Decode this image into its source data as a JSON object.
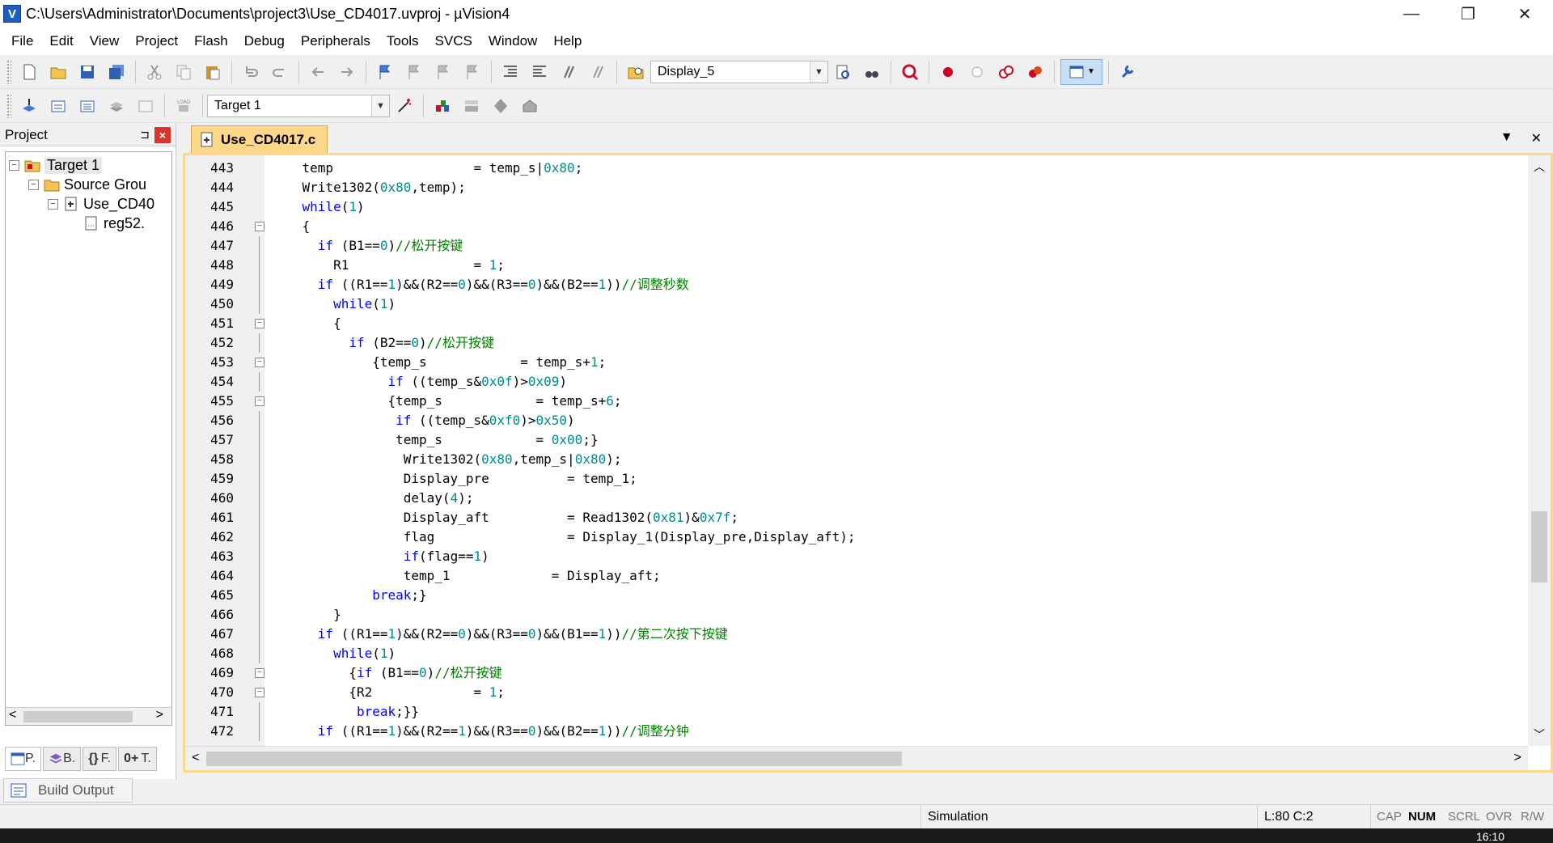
{
  "window": {
    "title": "C:\\Users\\Administrator\\Documents\\project3\\Use_CD4017.uvproj - µVision4",
    "logo": "V",
    "buttons": {
      "minimize": "—",
      "restore": "❐",
      "close": "✕"
    }
  },
  "menu": [
    "File",
    "Edit",
    "View",
    "Project",
    "Flash",
    "Debug",
    "Peripherals",
    "Tools",
    "SVCS",
    "Window",
    "Help"
  ],
  "toolbar": {
    "find_combo": "Display_5",
    "target_combo": "Target 1"
  },
  "project_panel": {
    "title": "Project",
    "pin": "⊐",
    "close": "×",
    "tree": [
      {
        "label": "Target 1",
        "icon": "target-folder-icon",
        "expander": "−"
      },
      {
        "label": "Source Grou",
        "icon": "folder-icon",
        "expander": "−"
      },
      {
        "label": "Use_CD40",
        "icon": "c-file-icon",
        "expander": "−"
      },
      {
        "label": "reg52.",
        "icon": "header-file-icon",
        "expander": ""
      }
    ],
    "scroll_left": "<",
    "scroll_right": ">",
    "tabs": [
      "P.",
      "B.",
      "F.",
      "T."
    ],
    "tab_icons": [
      "{}",
      "0+"
    ]
  },
  "editor": {
    "tab_label": "Use_CD4017.c",
    "tab_dropdown": "▼",
    "tab_close": "✕",
    "scroll_up": "︿",
    "scroll_down": "﹀",
    "scroll_left": "<",
    "scroll_right": ">",
    "lines": [
      {
        "n": "443",
        "fold": "",
        "t": [
          [
            "    temp                  = temp_s|",
            ""
          ],
          [
            "0x80",
            "num"
          ],
          [
            ";",
            ""
          ]
        ]
      },
      {
        "n": "444",
        "fold": "",
        "t": [
          [
            "    Write1302(",
            ""
          ],
          [
            "0x80",
            "num"
          ],
          [
            ",temp);",
            ""
          ]
        ]
      },
      {
        "n": "445",
        "fold": "",
        "t": [
          [
            "    ",
            ""
          ],
          [
            "while",
            "kw"
          ],
          [
            "(",
            ""
          ],
          [
            "1",
            "num"
          ],
          [
            ")",
            ""
          ]
        ]
      },
      {
        "n": "446",
        "fold": "−",
        "t": [
          [
            "    {",
            ""
          ]
        ]
      },
      {
        "n": "447",
        "fold": "",
        "t": [
          [
            "      ",
            ""
          ],
          [
            "if",
            "kw"
          ],
          [
            " (B1==",
            ""
          ],
          [
            "0",
            "num"
          ],
          [
            ")",
            ""
          ],
          [
            "//松开按键",
            "cmt"
          ]
        ]
      },
      {
        "n": "448",
        "fold": "",
        "t": [
          [
            "        R1                = ",
            ""
          ],
          [
            "1",
            "num"
          ],
          [
            ";",
            ""
          ]
        ]
      },
      {
        "n": "449",
        "fold": "",
        "t": [
          [
            "      ",
            ""
          ],
          [
            "if",
            "kw"
          ],
          [
            " ((R1==",
            ""
          ],
          [
            "1",
            "num"
          ],
          [
            ")&&(R2==",
            ""
          ],
          [
            "0",
            "num"
          ],
          [
            ")&&(R3==",
            ""
          ],
          [
            "0",
            "num"
          ],
          [
            ")&&(B2==",
            ""
          ],
          [
            "1",
            "num"
          ],
          [
            "))",
            ""
          ],
          [
            "//调整秒数",
            "cmt"
          ]
        ]
      },
      {
        "n": "450",
        "fold": "",
        "t": [
          [
            "        ",
            ""
          ],
          [
            "while",
            "kw"
          ],
          [
            "(",
            ""
          ],
          [
            "1",
            "num"
          ],
          [
            ")",
            ""
          ]
        ]
      },
      {
        "n": "451",
        "fold": "−",
        "t": [
          [
            "        {",
            ""
          ]
        ]
      },
      {
        "n": "452",
        "fold": "",
        "t": [
          [
            "          ",
            ""
          ],
          [
            "if",
            "kw"
          ],
          [
            " (B2==",
            ""
          ],
          [
            "0",
            "num"
          ],
          [
            ")",
            ""
          ],
          [
            "//松开按键",
            "cmt"
          ]
        ]
      },
      {
        "n": "453",
        "fold": "−",
        "t": [
          [
            "             {temp_s            = temp_s+",
            ""
          ],
          [
            "1",
            "num"
          ],
          [
            ";",
            ""
          ]
        ]
      },
      {
        "n": "454",
        "fold": "",
        "t": [
          [
            "               ",
            ""
          ],
          [
            "if",
            "kw"
          ],
          [
            " ((temp_s&",
            ""
          ],
          [
            "0x0f",
            "num"
          ],
          [
            ")>",
            ""
          ],
          [
            "0x09",
            "num"
          ],
          [
            ")",
            ""
          ]
        ]
      },
      {
        "n": "455",
        "fold": "−",
        "t": [
          [
            "               {temp_s            = temp_s+",
            ""
          ],
          [
            "6",
            "num"
          ],
          [
            ";",
            ""
          ]
        ]
      },
      {
        "n": "456",
        "fold": "",
        "t": [
          [
            "                ",
            ""
          ],
          [
            "if",
            "kw"
          ],
          [
            " ((temp_s&",
            ""
          ],
          [
            "0xf0",
            "num"
          ],
          [
            ")>",
            ""
          ],
          [
            "0x50",
            "num"
          ],
          [
            ")",
            ""
          ]
        ]
      },
      {
        "n": "457",
        "fold": "",
        "t": [
          [
            "                temp_s            = ",
            ""
          ],
          [
            "0x00",
            "num"
          ],
          [
            ";}",
            ""
          ]
        ]
      },
      {
        "n": "458",
        "fold": "",
        "t": [
          [
            "                 Write1302(",
            ""
          ],
          [
            "0x80",
            "num"
          ],
          [
            ",temp_s|",
            ""
          ],
          [
            "0x80",
            "num"
          ],
          [
            ");",
            ""
          ]
        ]
      },
      {
        "n": "459",
        "fold": "",
        "t": [
          [
            "                 Display_pre          = temp_1;",
            ""
          ]
        ]
      },
      {
        "n": "460",
        "fold": "",
        "t": [
          [
            "                 delay(",
            ""
          ],
          [
            "4",
            "num"
          ],
          [
            ");",
            ""
          ]
        ]
      },
      {
        "n": "461",
        "fold": "",
        "t": [
          [
            "                 Display_aft          = Read1302(",
            ""
          ],
          [
            "0x81",
            "num"
          ],
          [
            ")&",
            ""
          ],
          [
            "0x7f",
            "num"
          ],
          [
            ";",
            ""
          ]
        ]
      },
      {
        "n": "462",
        "fold": "",
        "t": [
          [
            "                 flag                 = Display_1(Display_pre,Display_aft);",
            ""
          ]
        ]
      },
      {
        "n": "463",
        "fold": "",
        "t": [
          [
            "                 ",
            ""
          ],
          [
            "if",
            "kw"
          ],
          [
            "(flag==",
            ""
          ],
          [
            "1",
            "num"
          ],
          [
            ")",
            ""
          ]
        ]
      },
      {
        "n": "464",
        "fold": "",
        "t": [
          [
            "                 temp_1             = Display_aft;",
            ""
          ]
        ]
      },
      {
        "n": "465",
        "fold": "",
        "t": [
          [
            "             ",
            ""
          ],
          [
            "break",
            "kw"
          ],
          [
            ";}",
            ""
          ]
        ]
      },
      {
        "n": "466",
        "fold": "",
        "t": [
          [
            "        }",
            ""
          ]
        ]
      },
      {
        "n": "467",
        "fold": "",
        "t": [
          [
            "      ",
            ""
          ],
          [
            "if",
            "kw"
          ],
          [
            " ((R1==",
            ""
          ],
          [
            "1",
            "num"
          ],
          [
            ")&&(R2==",
            ""
          ],
          [
            "0",
            "num"
          ],
          [
            ")&&(R3==",
            ""
          ],
          [
            "0",
            "num"
          ],
          [
            ")&&(B1==",
            ""
          ],
          [
            "1",
            "num"
          ],
          [
            "))",
            ""
          ],
          [
            "//第二次按下按键",
            "cmt"
          ]
        ]
      },
      {
        "n": "468",
        "fold": "",
        "t": [
          [
            "        ",
            ""
          ],
          [
            "while",
            "kw"
          ],
          [
            "(",
            ""
          ],
          [
            "1",
            "num"
          ],
          [
            ")",
            ""
          ]
        ]
      },
      {
        "n": "469",
        "fold": "−",
        "t": [
          [
            "          {",
            ""
          ],
          [
            "if",
            "kw"
          ],
          [
            " (B1==",
            ""
          ],
          [
            "0",
            "num"
          ],
          [
            ")",
            ""
          ],
          [
            "//松开按键",
            "cmt"
          ]
        ]
      },
      {
        "n": "470",
        "fold": "−",
        "t": [
          [
            "          {R2             = ",
            ""
          ],
          [
            "1",
            "num"
          ],
          [
            ";",
            ""
          ]
        ]
      },
      {
        "n": "471",
        "fold": "",
        "t": [
          [
            "           ",
            ""
          ],
          [
            "break",
            "kw"
          ],
          [
            ";}}",
            ""
          ]
        ]
      },
      {
        "n": "472",
        "fold": "",
        "t": [
          [
            "      ",
            ""
          ],
          [
            "if",
            "kw"
          ],
          [
            " ((R1==",
            ""
          ],
          [
            "1",
            "num"
          ],
          [
            ")&&(R2==",
            ""
          ],
          [
            "1",
            "num"
          ],
          [
            ")&&(R3==",
            ""
          ],
          [
            "0",
            "num"
          ],
          [
            ")&&(B2==",
            ""
          ],
          [
            "1",
            "num"
          ],
          [
            "))",
            ""
          ],
          [
            "//调整分钟",
            "cmt"
          ]
        ]
      }
    ]
  },
  "bottom": {
    "build_output_tab": "Build Output"
  },
  "status": {
    "mode": "Simulation",
    "position": "L:80 C:2",
    "indicators": [
      {
        "label": "CAP",
        "on": false
      },
      {
        "label": "NUM",
        "on": true
      },
      {
        "label": "SCRL",
        "on": false
      },
      {
        "label": "OVR",
        "on": false
      },
      {
        "label": "R/W",
        "on": false
      }
    ]
  },
  "taskbar": {
    "clock": "16:10"
  },
  "colors": {
    "keyword": "#0000ff",
    "number": "#008b8b",
    "comment": "#008000",
    "tab_accent": "#fdd88a"
  }
}
